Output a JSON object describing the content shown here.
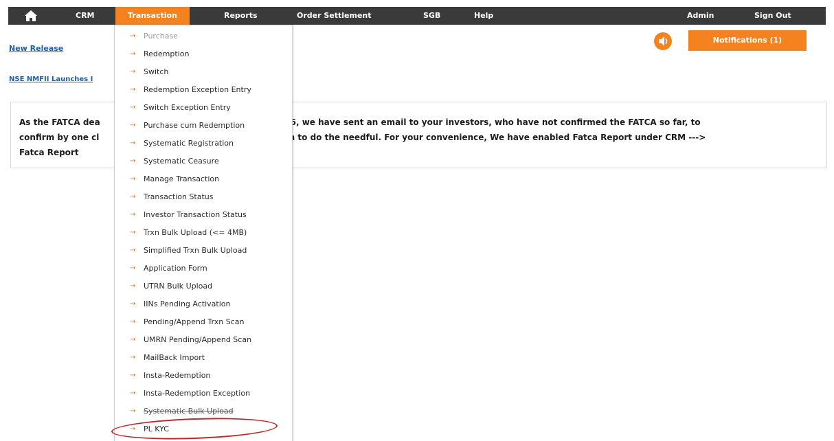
{
  "nav": {
    "items": [
      "CRM",
      "Transaction",
      "Reports",
      "Order Settlement",
      "SGB",
      "Help"
    ],
    "admin": "Admin",
    "signout": "Sign Out",
    "active_color": "#f4821f",
    "bar_color": "#3a3a3a"
  },
  "links": {
    "new_release": "New Release",
    "nse_launch": "NSE NMFII Launches I"
  },
  "notifications": {
    "label": "Notifications  (1)"
  },
  "announcement": {
    "left_part": "As the FATCA dea",
    "text_line1": "As the FATCA dea",
    "text_line1_rest": "t 2016, we have sent an email to your investors, who have not confirmed the FATCA so far, to",
    "text_line2": "confirm by one cl",
    "text_line2_rest": "them to do the needful. For your convenience, We have enabled Fatca Report under CRM --->",
    "text_line3": "Fatca Report"
  },
  "menu": {
    "items": [
      "Purchase",
      "Redemption",
      "Switch",
      "Redemption Exception Entry",
      "Switch Exception Entry",
      "Purchase cum Redemption",
      "Systematic Registration",
      "Systematic Ceasure",
      "Manage Transaction",
      "Transaction Status",
      "Investor Transaction Status",
      "Trxn Bulk Upload (<= 4MB)",
      "Simplified Trxn Bulk Upload",
      "Application Form",
      "UTRN Bulk Upload",
      "IINs Pending Activation",
      "Pending/Append Trxn Scan",
      "UMRN Pending/Append Scan",
      "MailBack Import",
      "Insta-Redemption",
      "Insta-Redemption Exception",
      "Systematic Bulk Upload",
      "PL KYC"
    ],
    "arrow": "→",
    "annotation_color": "#c0282c"
  }
}
